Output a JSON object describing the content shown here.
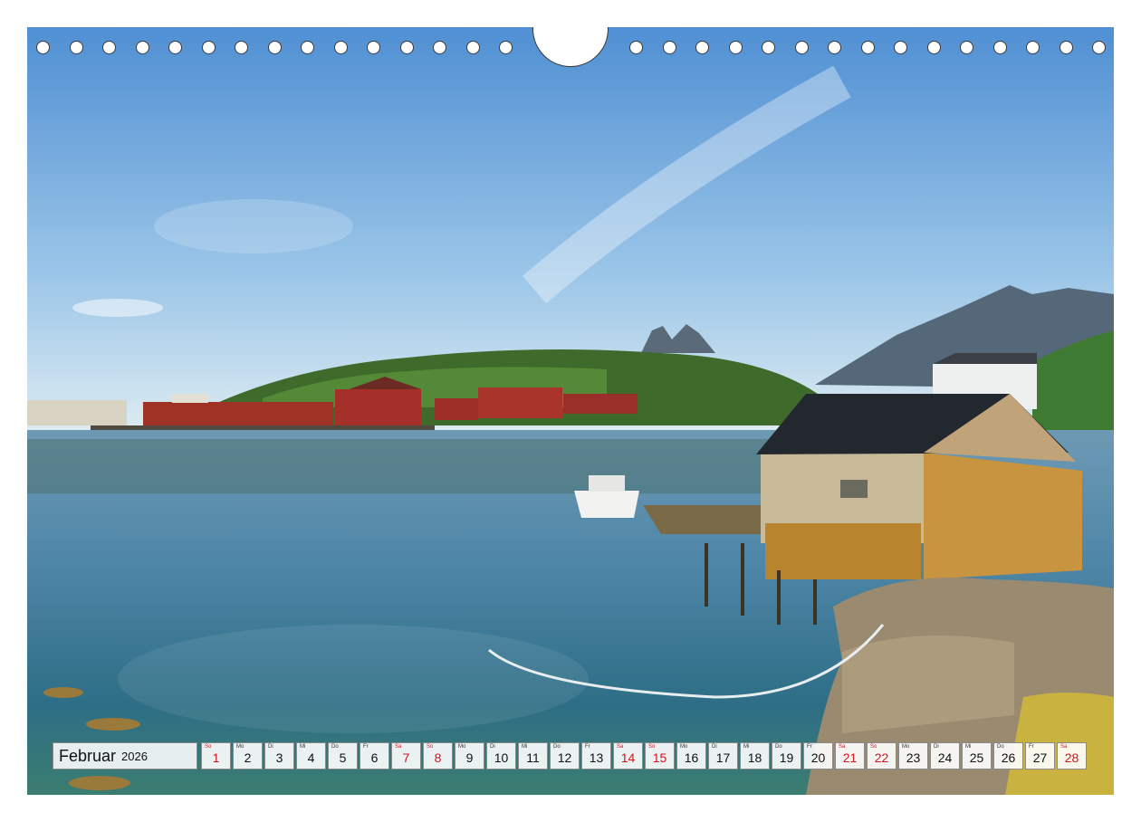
{
  "calendar": {
    "month": "Februar",
    "year": "2026",
    "days": [
      {
        "dow": "So",
        "num": "1",
        "red": true
      },
      {
        "dow": "Mo",
        "num": "2",
        "red": false
      },
      {
        "dow": "Di",
        "num": "3",
        "red": false
      },
      {
        "dow": "Mi",
        "num": "4",
        "red": false
      },
      {
        "dow": "Do",
        "num": "5",
        "red": false
      },
      {
        "dow": "Fr",
        "num": "6",
        "red": false
      },
      {
        "dow": "Sa",
        "num": "7",
        "red": true
      },
      {
        "dow": "So",
        "num": "8",
        "red": true
      },
      {
        "dow": "Mo",
        "num": "9",
        "red": false
      },
      {
        "dow": "Di",
        "num": "10",
        "red": false
      },
      {
        "dow": "Mi",
        "num": "11",
        "red": false
      },
      {
        "dow": "Do",
        "num": "12",
        "red": false
      },
      {
        "dow": "Fr",
        "num": "13",
        "red": false
      },
      {
        "dow": "Sa",
        "num": "14",
        "red": true
      },
      {
        "dow": "So",
        "num": "15",
        "red": true
      },
      {
        "dow": "Mo",
        "num": "16",
        "red": false
      },
      {
        "dow": "Di",
        "num": "17",
        "red": false
      },
      {
        "dow": "Mi",
        "num": "18",
        "red": false
      },
      {
        "dow": "Do",
        "num": "19",
        "red": false
      },
      {
        "dow": "Fr",
        "num": "20",
        "red": false
      },
      {
        "dow": "Sa",
        "num": "21",
        "red": true
      },
      {
        "dow": "So",
        "num": "22",
        "red": true
      },
      {
        "dow": "Mo",
        "num": "23",
        "red": false
      },
      {
        "dow": "Di",
        "num": "24",
        "red": false
      },
      {
        "dow": "Mi",
        "num": "25",
        "red": false
      },
      {
        "dow": "Do",
        "num": "26",
        "red": false
      },
      {
        "dow": "Fr",
        "num": "27",
        "red": false
      },
      {
        "dow": "Sa",
        "num": "28",
        "red": true
      }
    ]
  },
  "colors": {
    "weekend_red": "#d2141e",
    "sky": "#5a9ad6",
    "water": "#2f6f8e"
  },
  "binding": {
    "hole_count_left": 15,
    "hole_count_right": 15
  }
}
